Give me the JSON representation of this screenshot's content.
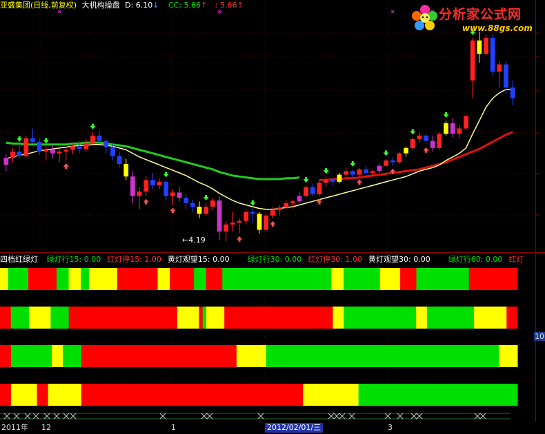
{
  "header": {
    "title": "亚盛集团(日线,前复权)",
    "indicator": "大机构操盘",
    "d_label": "D: 6.10",
    "d_arrow": "↓",
    "cc_label": "CC: 5.66",
    "cc_arrow": "↑",
    "extra_label": ": 5.66",
    "extra_arrow": "↑"
  },
  "logo": {
    "text": "分析家公式网",
    "url": "www.88gs.com"
  },
  "annotation": {
    "low_price": "4.19"
  },
  "subheader": {
    "title": "四档红绿灯",
    "items": [
      {
        "text": "绿灯行15: 0.00",
        "color": "#00e000"
      },
      {
        "text": "红灯停15: 1.00",
        "color": "#ff3030"
      },
      {
        "text": "黄灯观望15: 0.00",
        "color": "#ffffff"
      },
      {
        "text": "绿灯行30: 0.00",
        "color": "#00e000"
      },
      {
        "text": "红灯停30: 1.00",
        "color": "#ff3030"
      },
      {
        "text": "黄灯观望30: 0.00",
        "color": "#ffffff"
      },
      {
        "text": "绿灯行60: 0.00",
        "color": "#00e000"
      },
      {
        "text": "红灯",
        "color": "#ff3030"
      }
    ]
  },
  "axis": {
    "dates": [
      "2011年",
      "12",
      "1",
      "2012/02/01/三",
      "3"
    ],
    "right_label": "10."
  },
  "colors": {
    "red": "#ff0000",
    "green": "#00e000",
    "yellow": "#ffff00",
    "up": "#ff2020",
    "down": "#2040ff"
  },
  "chart_data": {
    "type": "candlestick",
    "candles": [
      [
        5.05,
        5.17,
        4.98,
        5.13
      ],
      [
        5.13,
        5.24,
        5.08,
        5.2
      ],
      [
        5.2,
        5.28,
        5.12,
        5.15
      ],
      [
        5.15,
        5.38,
        5.13,
        5.35
      ],
      [
        5.35,
        5.46,
        5.3,
        5.31
      ],
      [
        5.31,
        5.35,
        5.16,
        5.2
      ],
      [
        5.2,
        5.26,
        5.1,
        5.22
      ],
      [
        5.22,
        5.28,
        5.12,
        5.18
      ],
      [
        5.18,
        5.24,
        5.08,
        5.2
      ],
      [
        5.2,
        5.25,
        5.1,
        5.22
      ],
      [
        5.22,
        5.3,
        5.17,
        5.26
      ],
      [
        5.26,
        5.32,
        5.18,
        5.23
      ],
      [
        5.23,
        5.34,
        5.2,
        5.3
      ],
      [
        5.3,
        5.42,
        5.28,
        5.38
      ],
      [
        5.38,
        5.44,
        5.3,
        5.32
      ],
      [
        5.32,
        5.34,
        5.18,
        5.25
      ],
      [
        5.25,
        5.3,
        5.1,
        5.15
      ],
      [
        5.15,
        5.2,
        5.02,
        5.06
      ],
      [
        5.06,
        5.12,
        4.88,
        4.92
      ],
      [
        4.92,
        4.98,
        4.62,
        4.7
      ],
      [
        4.7,
        4.8,
        4.55,
        4.75
      ],
      [
        4.75,
        4.92,
        4.7,
        4.88
      ],
      [
        4.88,
        4.96,
        4.78,
        4.82
      ],
      [
        4.82,
        4.9,
        4.78,
        4.86
      ],
      [
        4.86,
        4.88,
        4.65,
        4.7
      ],
      [
        4.7,
        4.78,
        4.6,
        4.74
      ],
      [
        4.74,
        4.8,
        4.64,
        4.68
      ],
      [
        4.68,
        4.72,
        4.55,
        4.62
      ],
      [
        4.62,
        4.66,
        4.52,
        4.58
      ],
      [
        4.58,
        4.64,
        4.45,
        4.5
      ],
      [
        4.5,
        4.62,
        4.48,
        4.58
      ],
      [
        4.58,
        4.68,
        4.54,
        4.65
      ],
      [
        4.65,
        4.7,
        4.2,
        4.3
      ],
      [
        4.3,
        4.42,
        4.19,
        4.38
      ],
      [
        4.38,
        4.52,
        4.3,
        4.4
      ],
      [
        4.4,
        4.45,
        4.28,
        4.42
      ],
      [
        4.42,
        4.55,
        4.38,
        4.52
      ],
      [
        4.52,
        4.56,
        4.4,
        4.5
      ],
      [
        4.5,
        4.52,
        4.28,
        4.32
      ],
      [
        4.32,
        4.5,
        4.3,
        4.48
      ],
      [
        4.48,
        4.58,
        4.45,
        4.54
      ],
      [
        4.54,
        4.6,
        4.48,
        4.57
      ],
      [
        4.57,
        4.66,
        4.55,
        4.62
      ],
      [
        4.62,
        4.66,
        4.56,
        4.64
      ],
      [
        4.64,
        4.74,
        4.62,
        4.7
      ],
      [
        4.7,
        4.82,
        4.68,
        4.8
      ],
      [
        4.8,
        4.84,
        4.7,
        4.72
      ],
      [
        4.72,
        4.88,
        4.7,
        4.85
      ],
      [
        4.85,
        4.92,
        4.8,
        4.88
      ],
      [
        4.88,
        4.9,
        4.82,
        4.86
      ],
      [
        4.86,
        4.96,
        4.84,
        4.94
      ],
      [
        4.94,
        5.02,
        4.9,
        4.98
      ],
      [
        4.98,
        5.0,
        4.9,
        4.94
      ],
      [
        4.94,
        5.02,
        4.92,
        5.0
      ],
      [
        5.0,
        5.04,
        4.93,
        4.96
      ],
      [
        4.96,
        5.0,
        4.92,
        4.98
      ],
      [
        4.98,
        5.06,
        4.96,
        5.04
      ],
      [
        5.04,
        5.12,
        5.02,
        5.1
      ],
      [
        5.1,
        5.14,
        5.04,
        5.08
      ],
      [
        5.08,
        5.2,
        5.06,
        5.18
      ],
      [
        5.18,
        5.26,
        5.14,
        5.24
      ],
      [
        5.24,
        5.36,
        5.22,
        5.34
      ],
      [
        5.34,
        5.42,
        5.3,
        5.38
      ],
      [
        5.38,
        5.4,
        5.28,
        5.32
      ],
      [
        5.32,
        5.38,
        5.2,
        5.24
      ],
      [
        5.24,
        5.42,
        5.22,
        5.4
      ],
      [
        5.4,
        5.55,
        5.38,
        5.52
      ],
      [
        5.52,
        5.58,
        5.36,
        5.4
      ],
      [
        5.4,
        5.5,
        5.35,
        5.46
      ],
      [
        5.46,
        5.62,
        5.44,
        5.6
      ],
      [
        6.0,
        6.48,
        5.8,
        6.45
      ],
      [
        6.45,
        6.55,
        6.2,
        6.3
      ],
      [
        6.3,
        6.52,
        6.28,
        6.48
      ],
      [
        6.48,
        6.52,
        6.05,
        6.1
      ],
      [
        6.1,
        6.22,
        5.92,
        6.18
      ],
      [
        6.18,
        6.22,
        5.85,
        5.92
      ],
      [
        5.92,
        6.0,
        5.72,
        5.8
      ]
    ],
    "ma_yellow": [
      5.12,
      5.14,
      5.16,
      5.17,
      5.19,
      5.21,
      5.22,
      5.23,
      5.24,
      5.25,
      5.26,
      5.27,
      5.27,
      5.28,
      5.28,
      5.27,
      5.26,
      5.24,
      5.22,
      5.18,
      5.14,
      5.11,
      5.08,
      5.05,
      5.02,
      4.99,
      4.96,
      4.93,
      4.89,
      4.85,
      4.82,
      4.78,
      4.73,
      4.69,
      4.65,
      4.62,
      4.6,
      4.58,
      4.56,
      4.55,
      4.55,
      4.56,
      4.57,
      4.58,
      4.6,
      4.62,
      4.64,
      4.66,
      4.68,
      4.7,
      4.72,
      4.74,
      4.76,
      4.78,
      4.8,
      4.82,
      4.84,
      4.86,
      4.88,
      4.9,
      4.92,
      4.95,
      4.98,
      5.0,
      5.02,
      5.05,
      5.1,
      5.14,
      5.18,
      5.24,
      5.4,
      5.55,
      5.7,
      5.8,
      5.86,
      5.9,
      5.9
    ],
    "ma_green": [
      5.3,
      5.29,
      5.29,
      5.28,
      5.28,
      5.28,
      5.28,
      5.28,
      5.28,
      5.28,
      5.29,
      5.29,
      5.3,
      5.3,
      5.3,
      5.29,
      5.28,
      5.27,
      5.26,
      5.24,
      5.22,
      5.2,
      5.18,
      5.16,
      5.14,
      5.12,
      5.1,
      5.08,
      5.06,
      5.04,
      5.02,
      5.0,
      4.97,
      4.95,
      4.93,
      4.92,
      4.91,
      4.9,
      4.89,
      4.89,
      4.89,
      4.89,
      4.9,
      4.9,
      4.91
    ],
    "ma_red": [
      4.88,
      4.88,
      4.89,
      4.89,
      4.9,
      4.9,
      4.91,
      4.92,
      4.93,
      4.94,
      4.95,
      4.96,
      4.97,
      4.98,
      4.99,
      5.0,
      5.02,
      5.04,
      5.06,
      5.08,
      5.11,
      5.14,
      5.17,
      5.2,
      5.23,
      5.27,
      5.31,
      5.35,
      5.39,
      5.42
    ],
    "up_arrows": [
      2,
      6,
      13,
      24,
      30,
      37,
      45,
      48,
      52,
      57,
      61,
      66,
      70
    ],
    "down_arrows": [
      9,
      21,
      25,
      35,
      40,
      47,
      53,
      58,
      63
    ],
    "purple_bars": [
      0,
      7,
      19,
      26,
      32,
      44,
      56,
      64,
      67
    ],
    "yellow_bars": [
      18,
      29,
      38,
      50,
      60,
      66,
      71
    ],
    "light_bars": [
      {
        "name": "bar-15",
        "segments": [
          [
            "yellow",
            2
          ],
          [
            "green",
            5
          ],
          [
            "red",
            7
          ],
          [
            "green",
            3
          ],
          [
            "yellow",
            3
          ],
          [
            "green",
            2
          ],
          [
            "yellow",
            7
          ],
          [
            "red",
            10
          ],
          [
            "yellow",
            3
          ],
          [
            "red",
            6
          ],
          [
            "green",
            3
          ],
          [
            "red",
            4
          ],
          [
            "green",
            27
          ],
          [
            "yellow",
            3
          ],
          [
            "green",
            9
          ],
          [
            "yellow",
            5
          ],
          [
            "red",
            1
          ],
          [
            "red",
            3
          ],
          [
            "green",
            13
          ],
          [
            "red",
            12
          ]
        ]
      },
      {
        "name": "bar-30",
        "segments": [
          [
            "red",
            3
          ],
          [
            "green",
            5
          ],
          [
            "yellow",
            6
          ],
          [
            "green",
            5
          ],
          [
            "red",
            30
          ],
          [
            "yellow",
            6
          ],
          [
            "red",
            1
          ],
          [
            "green",
            1
          ],
          [
            "yellow",
            5
          ],
          [
            "red",
            30
          ],
          [
            "yellow",
            3
          ],
          [
            "green",
            20
          ],
          [
            "yellow",
            3
          ],
          [
            "green",
            13
          ],
          [
            "yellow",
            9
          ],
          [
            "red",
            3
          ]
        ]
      },
      {
        "name": "bar-60",
        "segments": [
          [
            "red",
            3
          ],
          [
            "green",
            11
          ],
          [
            "yellow",
            3
          ],
          [
            "green",
            5
          ],
          [
            "red",
            42
          ],
          [
            "yellow",
            8
          ],
          [
            "green",
            63
          ],
          [
            "yellow",
            5
          ]
        ]
      },
      {
        "name": "bar-120",
        "segments": [
          [
            "red",
            3
          ],
          [
            "yellow",
            7
          ],
          [
            "red",
            3
          ],
          [
            "yellow",
            9
          ],
          [
            "red",
            60
          ],
          [
            "yellow",
            15
          ],
          [
            "green",
            43
          ]
        ]
      }
    ]
  }
}
